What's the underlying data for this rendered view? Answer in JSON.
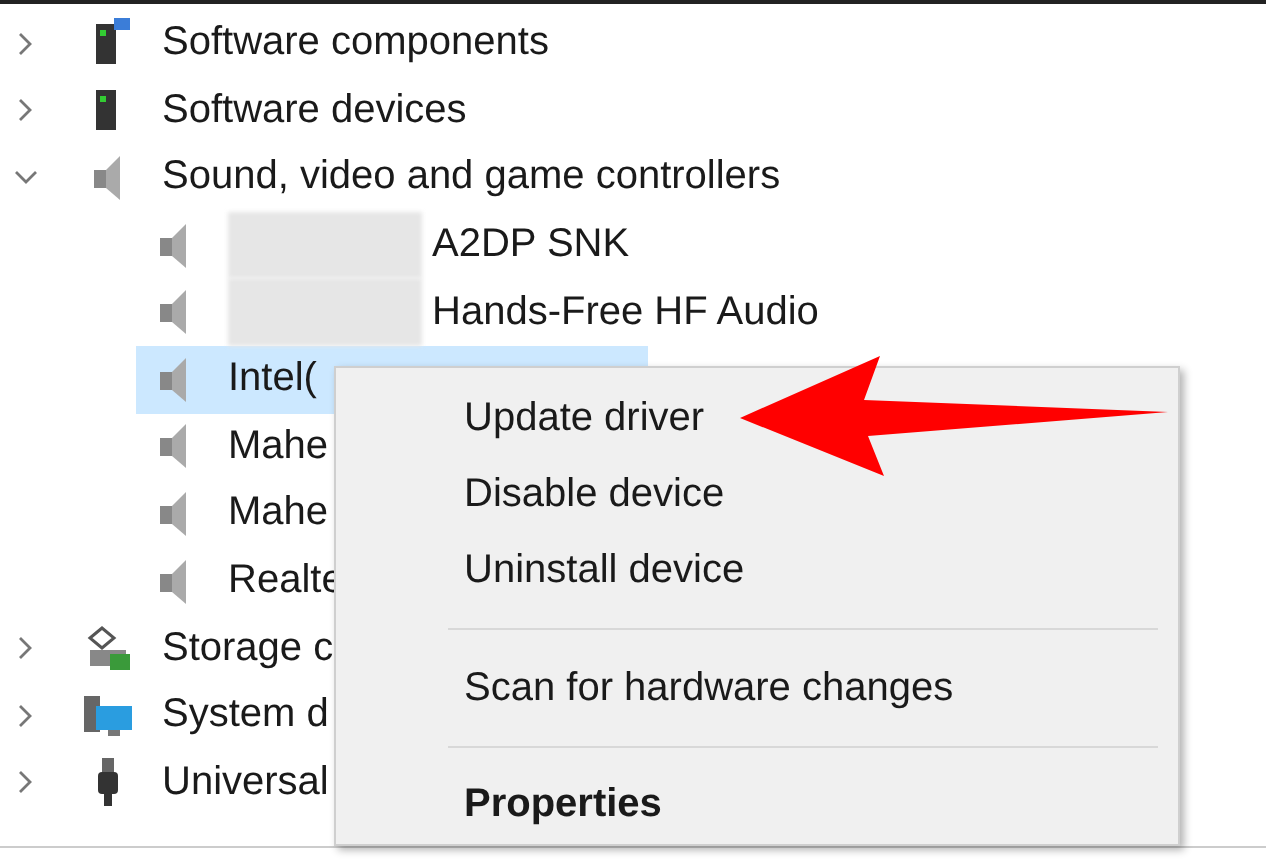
{
  "tree": [
    {
      "label": "Software components",
      "expanded": false
    },
    {
      "label": "Software devices",
      "expanded": false
    },
    {
      "label": "Sound, video and game controllers",
      "expanded": true,
      "children": [
        {
          "label": "A2DP SNK",
          "redacted": true,
          "selected": false
        },
        {
          "label": "Hands-Free HF Audio",
          "redacted": true,
          "selected": false
        },
        {
          "label": "Intel(",
          "redacted": false,
          "selected": true
        },
        {
          "label": "Mahe",
          "redacted": false,
          "selected": false
        },
        {
          "label": "Mahe",
          "redacted": false,
          "selected": false
        },
        {
          "label": "Realte",
          "redacted": false,
          "selected": false
        }
      ]
    },
    {
      "label": "Storage c",
      "expanded": false
    },
    {
      "label": "System d",
      "expanded": false
    },
    {
      "label": "Universal",
      "expanded": false
    }
  ],
  "context_menu": [
    {
      "label": "Update driver",
      "kind": "item",
      "separator_before": false
    },
    {
      "label": "Disable device",
      "kind": "item",
      "separator_before": false
    },
    {
      "label": "Uninstall device",
      "kind": "item",
      "separator_before": false
    },
    {
      "label": "Scan for hardware changes",
      "kind": "item",
      "separator_before": true
    },
    {
      "label": "Properties",
      "kind": "default",
      "separator_before": true
    }
  ]
}
